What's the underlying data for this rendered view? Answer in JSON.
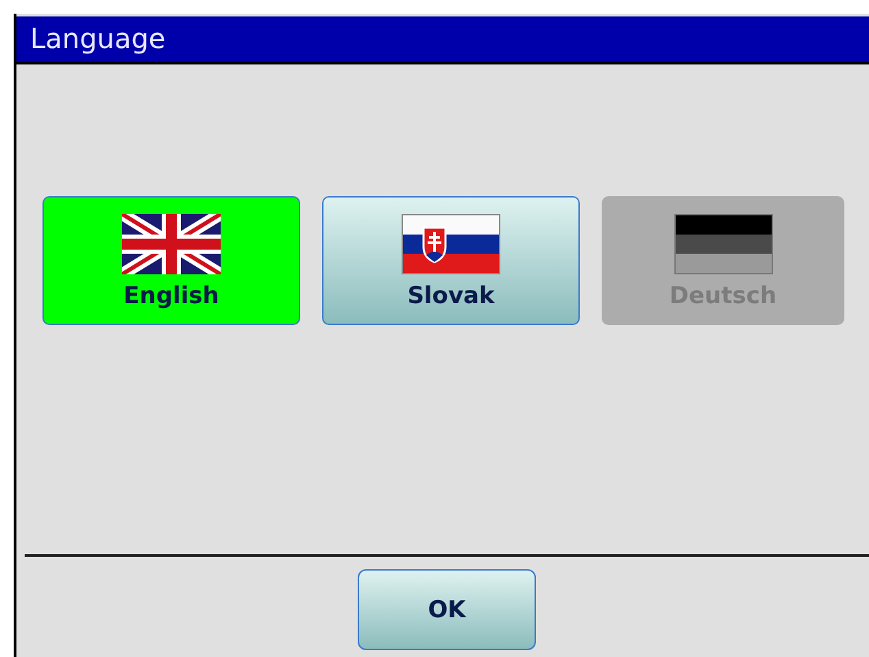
{
  "window": {
    "title": "Language"
  },
  "languages": [
    {
      "label": "English",
      "kind": "uk",
      "selected": true,
      "disabled": false
    },
    {
      "label": "Slovak",
      "kind": "sk",
      "selected": false,
      "disabled": false
    },
    {
      "label": "Deutsch",
      "kind": "de",
      "selected": false,
      "disabled": true
    }
  ],
  "buttons": [
    "OK"
  ]
}
